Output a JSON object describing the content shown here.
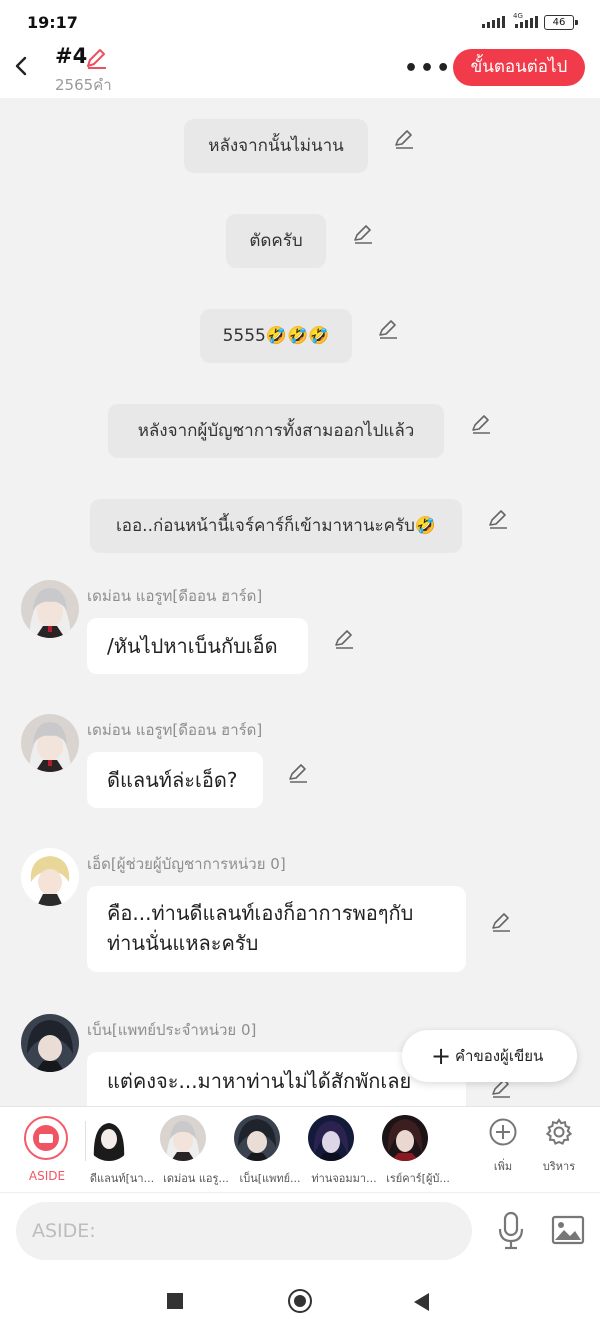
{
  "status_bar": {
    "time": "19:17",
    "network": "4G",
    "battery": "46"
  },
  "header": {
    "title": "#4",
    "word_count": "2565คำ",
    "more": "•••",
    "next_label": "ขั้นตอนต่อไป"
  },
  "narration": [
    {
      "text": "หลังจากนั้นไม่นาน"
    },
    {
      "text": "ตัดครับ"
    },
    {
      "text": "5555🤣🤣🤣"
    },
    {
      "text": "หลังจากผู้บัญชาการทั้งสามออกไปแล้ว"
    },
    {
      "text": "เออ..ก่อนหน้านี้เจร์คาร์ก็เข้ามาหานะครับ🤣"
    }
  ],
  "messages": [
    {
      "speaker": "เดม่อน แอรูท[ดีออน ฮาร์ด]",
      "lines": [
        "/หันไปหาเบ็นกับเอ็ด"
      ]
    },
    {
      "speaker": "เดม่อน แอรูท[ดีออน ฮาร์ด]",
      "lines": [
        "ดีแลนท์ล่ะเอ็ด?"
      ]
    },
    {
      "speaker": "เอ็ด[ผู้ช่วยผู้บัญชาการหน่วย 0]",
      "lines": [
        "คือ...ท่านดีแลนท์เองก็อาการพอๆกับ",
        "ท่านนั่นแหละครับ"
      ]
    },
    {
      "speaker": "เบ็น[แพทย์ประจำหน่วย 0]",
      "lines": [
        "แต่คงจะ...มาหาท่านไม่ได้สักพักเลย"
      ]
    }
  ],
  "fab": {
    "label": "คำของผู้เขียน"
  },
  "character_bar": {
    "aside_label": "ASIDE",
    "characters": [
      {
        "label": "ดีแลนท์[นา..."
      },
      {
        "label": "เดม่อน แอรู..."
      },
      {
        "label": "เบ็น[แพทย์..."
      },
      {
        "label": "ท่านจอมมา..."
      },
      {
        "label": "เรย์คาร์[ผู้บั..."
      }
    ],
    "add_label": "เพิ่ม",
    "manage_label": "บริหาร"
  },
  "input": {
    "placeholder": "ASIDE:"
  },
  "colors": {
    "accent": "#f23b4a",
    "narration_bg": "#e8e8e8",
    "chat_bg": "#f2f2f2"
  }
}
